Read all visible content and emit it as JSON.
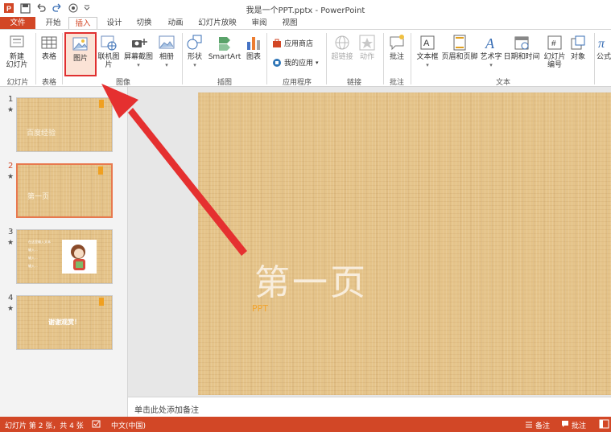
{
  "titlebar": {
    "title": "我是一个PPT.pptx - PowerPoint",
    "qat_icons": [
      "powerpoint-logo-icon",
      "save-icon",
      "undo-icon",
      "redo-icon",
      "touch-mode-icon",
      "customize-qat-icon"
    ]
  },
  "tabs": {
    "file": "文件",
    "items": [
      "开始",
      "插入",
      "设计",
      "切换",
      "动画",
      "幻灯片放映",
      "审阅",
      "视图"
    ],
    "active": "插入"
  },
  "ribbon": {
    "new_slide": "新建\n幻灯片",
    "new_slide_line1": "新建",
    "new_slide_line2": "幻灯片",
    "table": "表格",
    "picture": "图片",
    "online_picture": "联机图片",
    "screenshot": "屏幕截图",
    "album": "相册",
    "shapes": "形状",
    "smartart": "SmartArt",
    "chart": "图表",
    "app_store": "应用商店",
    "my_apps": "我的应用",
    "hyperlink": "超链接",
    "action": "动作",
    "comment": "批注",
    "textbox": "文本框",
    "header_footer": "页眉和页脚",
    "wordart": "艺术字",
    "date_time": "日期和时间",
    "slide_number_l1": "幻灯片",
    "slide_number_l2": "编号",
    "object": "对象",
    "formula": "公式",
    "groups": {
      "slides": "幻灯片",
      "tables": "表格",
      "images": "图像",
      "illustrations": "插图",
      "apps": "应用程序",
      "links": "链接",
      "comments": "批注",
      "text": "文本"
    }
  },
  "thumbnails": [
    {
      "number": "1",
      "star": "★",
      "text": "百度经验",
      "active": false
    },
    {
      "number": "2",
      "star": "★",
      "text": "第一页",
      "active": true
    },
    {
      "number": "3",
      "star": "★",
      "lines": [
        "在这里输入文本",
        "输入...",
        "输入...",
        "输入..."
      ],
      "active": false
    },
    {
      "number": "4",
      "star": "★",
      "text": "谢谢观赏！",
      "active": false
    }
  ],
  "slide": {
    "title": "第一页",
    "subtitle": "PPT"
  },
  "notes": {
    "placeholder": "单击此处添加备注"
  },
  "statusbar": {
    "slide_info": "幻灯片 第 2 张，共 4 张",
    "language": "中文(中国)",
    "notes": "备注",
    "comments": "批注"
  },
  "colors": {
    "accent": "#d24726",
    "highlight_box": "#e03030",
    "wood": "#e5c48a"
  }
}
